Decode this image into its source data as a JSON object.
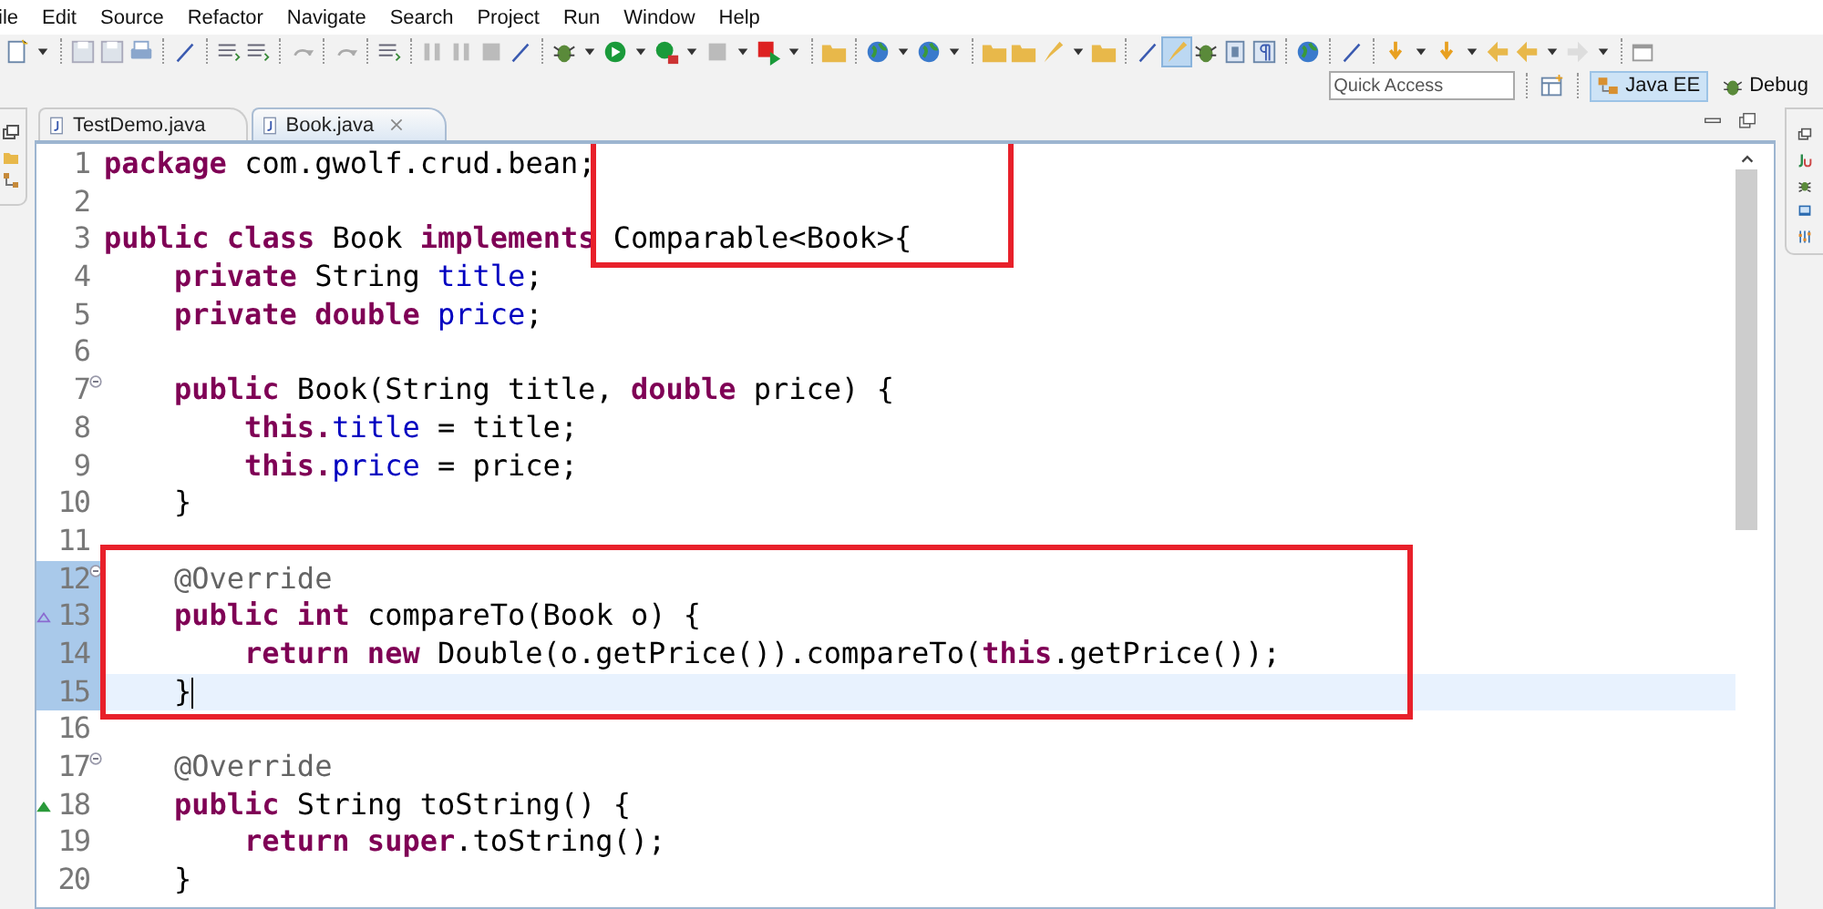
{
  "menu_bar": [
    "ile",
    "Edit",
    "Source",
    "Refactor",
    "Navigate",
    "Search",
    "Project",
    "Run",
    "Window",
    "Help"
  ],
  "quick_access": {
    "placeholder": "Quick Access"
  },
  "perspectives": [
    {
      "label": "Java EE",
      "selected": true
    },
    {
      "label": "Debug",
      "selected": false
    }
  ],
  "editor_tabs": [
    {
      "label": "TestDemo.java",
      "selected": false,
      "closable": false
    },
    {
      "label": "Book.java",
      "selected": true,
      "closable": true
    }
  ],
  "code_lines": [
    {
      "number": "1",
      "boxed": true,
      "tokens": [
        {
          "kind": "keyword",
          "text": "package"
        },
        {
          "kind": "plain",
          "text": " com.gwolf.crud.bean;"
        }
      ]
    },
    {
      "number": "2",
      "boxed": true
    },
    {
      "number": "3",
      "boxed": true,
      "tokens": [
        {
          "kind": "keyword",
          "text": "public class"
        },
        {
          "kind": "plain",
          "text": " Book "
        },
        {
          "kind": "keyword",
          "text": "implements"
        },
        {
          "kind": "plain",
          "text": " Comparable<Book>{"
        }
      ],
      "children": [
        {
          "number": "4",
          "tokens": [
            {
              "kind": "keyword",
              "text": "private"
            },
            {
              "kind": "plain",
              "text": " String "
            },
            {
              "kind": "field",
              "text": "title"
            },
            {
              "kind": "plain",
              "text": ";"
            }
          ]
        },
        {
          "number": "5",
          "tokens": [
            {
              "kind": "keyword",
              "text": "private double "
            },
            {
              "kind": "field",
              "text": "price"
            },
            {
              "kind": "plain",
              "text": ";"
            }
          ]
        },
        {
          "number": "6"
        },
        {
          "number": "7",
          "fold": true,
          "tokens": [
            {
              "kind": "keyword",
              "text": "public"
            },
            {
              "kind": "plain",
              "text": " Book(String title, "
            },
            {
              "kind": "keyword",
              "text": "double"
            },
            {
              "kind": "plain",
              "text": " price) {"
            }
          ],
          "children": [
            {
              "number": "8",
              "tokens": [
                {
                  "kind": "keyword",
                  "text": "this."
                },
                {
                  "kind": "field",
                  "text": "title"
                },
                {
                  "kind": "plain",
                  "text": " = title;"
                }
              ]
            },
            {
              "number": "9",
              "tokens": [
                {
                  "kind": "keyword",
                  "text": "this."
                },
                {
                  "kind": "field",
                  "text": "price"
                },
                {
                  "kind": "plain",
                  "text": " = price;"
                }
              ]
            }
          ]
        },
        {
          "number": "10",
          "tokens": [
            {
              "kind": "plain",
              "text": "}"
            }
          ]
        },
        {
          "number": "11"
        },
        {
          "number": "12",
          "fold": true,
          "changed": true,
          "boxed": true,
          "tokens": [
            {
              "kind": "annotation",
              "text": "@Override"
            }
          ]
        },
        {
          "number": "13",
          "changed": true,
          "boxed": true,
          "implements_marker": true,
          "tokens": [
            {
              "kind": "keyword",
              "text": "public int"
            },
            {
              "kind": "plain",
              "text": " compareTo(Book o) {"
            }
          ],
          "children": [
            {
              "number": "14",
              "changed": true,
              "boxed": true,
              "tokens": [
                {
                  "kind": "keyword",
                  "text": "return new"
                },
                {
                  "kind": "plain",
                  "text": " Double(o.getPrice()).compareTo("
                },
                {
                  "kind": "keyword",
                  "text": "this"
                },
                {
                  "kind": "plain",
                  "text": ".getPrice());"
                }
              ]
            }
          ]
        },
        {
          "number": "15",
          "changed": true,
          "boxed": true,
          "current": true,
          "tokens": [
            {
              "kind": "plain",
              "text": "}"
            }
          ]
        },
        {
          "number": "16"
        },
        {
          "number": "17",
          "fold": true,
          "tokens": [
            {
              "kind": "annotation",
              "text": "@Override"
            }
          ]
        },
        {
          "number": "18",
          "override_marker": true,
          "tokens": [
            {
              "kind": "keyword",
              "text": "public"
            },
            {
              "kind": "plain",
              "text": " String toString() {"
            }
          ],
          "children": [
            {
              "number": "19",
              "tokens": [
                {
                  "kind": "keyword",
                  "text": "return super"
                },
                {
                  "kind": "plain",
                  "text": ".toString();"
                }
              ]
            }
          ]
        },
        {
          "number": "20",
          "tokens": [
            {
              "kind": "plain",
              "text": "}"
            }
          ]
        }
      ]
    }
  ]
}
